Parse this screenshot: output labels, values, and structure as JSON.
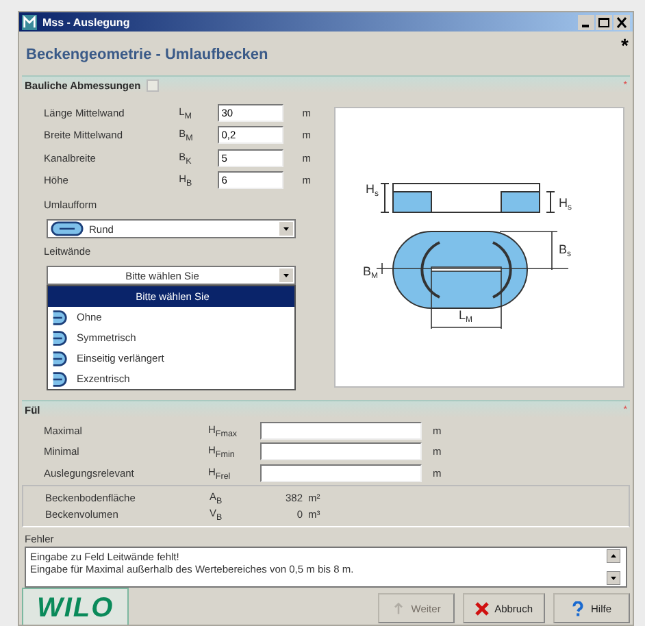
{
  "window": {
    "title": "Mss - Auslegung"
  },
  "header": {
    "title": "Beckengeometrie - Umlaufbecken",
    "mark": "*"
  },
  "dimensions": {
    "title": "Bauliche Abmessungen",
    "mark": "*",
    "fields": [
      {
        "label": "Länge Mittelwand",
        "symbol": "L$_{M}$",
        "value": "30",
        "unit": "m"
      },
      {
        "label": "Breite Mittelwand",
        "symbol": "B$_{M}$",
        "value": "0,2",
        "unit": "m"
      },
      {
        "label": "Kanalbreite",
        "symbol": "B$_{K}$",
        "value": "5",
        "unit": "m"
      },
      {
        "label": "Höhe",
        "symbol": "H$_{B}$",
        "value": "6",
        "unit": "m"
      }
    ],
    "shape": {
      "label": "Umlaufform",
      "value": "Rund"
    },
    "guide_walls": {
      "label": "Leitwände",
      "value": "Bitte wählen Sie",
      "expanded": true,
      "options": [
        {
          "label": "Bitte wählen Sie",
          "kind": "placeholder",
          "selected": true
        },
        {
          "label": "Ohne",
          "kind": "shape",
          "selected": false
        },
        {
          "label": "Symmetrisch",
          "kind": "shape",
          "selected": false
        },
        {
          "label": "Einseitig verlängert",
          "kind": "shape",
          "selected": false
        },
        {
          "label": "Exzentrisch",
          "kind": "shape",
          "selected": false
        }
      ]
    },
    "diagram": {
      "labels": [
        {
          "text": "H",
          "sub": "s"
        },
        {
          "text": "H",
          "sub": "s"
        },
        {
          "text": "B",
          "sub": "s"
        },
        {
          "text": "B",
          "sub": "M"
        },
        {
          "text": "L",
          "sub": "M"
        }
      ]
    }
  },
  "fill_levels": {
    "title": "Fül",
    "mark": "*",
    "fields": [
      {
        "label": "Maximal",
        "symbol": "H$_{Fmax}$",
        "unit": "m"
      },
      {
        "label": "Minimal",
        "symbol": "H$_{Fmin}$",
        "unit": "m"
      },
      {
        "label": "Auslegungsrelevant",
        "symbol": "H$_{Frel}$",
        "unit": "m"
      }
    ]
  },
  "results": [
    {
      "label": "Beckenbodenfläche",
      "symbol": "A$_{B}$",
      "value": "382",
      "unit": "m²"
    },
    {
      "label": "Beckenvolumen",
      "symbol": "V$_{B}$",
      "value": "0",
      "unit": "m³"
    }
  ],
  "errors": {
    "label": "Fehler",
    "messages": [
      "Eingabe zu Feld Leitwände fehlt!",
      "Eingabe für Maximal außerhalb des Wertebereiches von 0,5 m bis 8 m."
    ]
  },
  "logo": "WILO",
  "buttons": [
    {
      "label": "Weiter",
      "kind": "next",
      "disabled": true
    },
    {
      "label": "Abbruch",
      "kind": "cancel",
      "disabled": false
    },
    {
      "label": "Hilfe",
      "kind": "help",
      "disabled": false
    }
  ]
}
